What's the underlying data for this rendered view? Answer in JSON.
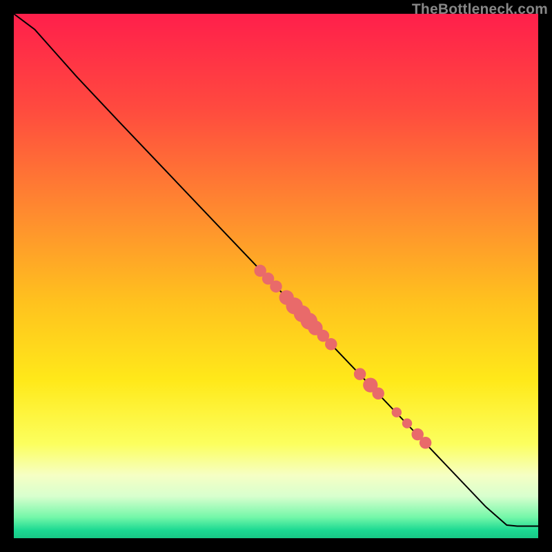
{
  "watermark": "TheBottleneck.com",
  "chart_data": {
    "type": "line",
    "title": "",
    "xlabel": "",
    "ylabel": "",
    "xlim": [
      0,
      100
    ],
    "ylim": [
      0,
      100
    ],
    "gradient_stops": [
      {
        "offset": 0,
        "color": "#ff1f4b"
      },
      {
        "offset": 18,
        "color": "#ff4a3f"
      },
      {
        "offset": 38,
        "color": "#ff8b2f"
      },
      {
        "offset": 55,
        "color": "#ffc21e"
      },
      {
        "offset": 70,
        "color": "#ffe91a"
      },
      {
        "offset": 82,
        "color": "#fcff5e"
      },
      {
        "offset": 88,
        "color": "#f6ffc4"
      },
      {
        "offset": 92,
        "color": "#d8ffce"
      },
      {
        "offset": 96,
        "color": "#74f7a9"
      },
      {
        "offset": 98.5,
        "color": "#1bd992"
      },
      {
        "offset": 100,
        "color": "#18c986"
      }
    ],
    "curve": [
      {
        "x": 0,
        "y": 100
      },
      {
        "x": 4,
        "y": 97
      },
      {
        "x": 8,
        "y": 92.5
      },
      {
        "x": 12,
        "y": 88
      },
      {
        "x": 20,
        "y": 79.5
      },
      {
        "x": 30,
        "y": 69
      },
      {
        "x": 40,
        "y": 58.5
      },
      {
        "x": 50,
        "y": 48
      },
      {
        "x": 60,
        "y": 37.5
      },
      {
        "x": 70,
        "y": 27
      },
      {
        "x": 80,
        "y": 16.5
      },
      {
        "x": 90,
        "y": 6
      },
      {
        "x": 94,
        "y": 2.5
      },
      {
        "x": 96,
        "y": 2.3
      },
      {
        "x": 100,
        "y": 2.3
      }
    ],
    "points": [
      {
        "x": 47,
        "y": 51,
        "r": 1.15
      },
      {
        "x": 48.5,
        "y": 49.5,
        "r": 1.15
      },
      {
        "x": 50,
        "y": 48,
        "r": 1.15
      },
      {
        "x": 52,
        "y": 45.9,
        "r": 1.4
      },
      {
        "x": 53.5,
        "y": 44.3,
        "r": 1.6
      },
      {
        "x": 55,
        "y": 42.8,
        "r": 1.6
      },
      {
        "x": 56.3,
        "y": 41.4,
        "r": 1.6
      },
      {
        "x": 57.5,
        "y": 40.1,
        "r": 1.4
      },
      {
        "x": 59,
        "y": 38.6,
        "r": 1.15
      },
      {
        "x": 60.5,
        "y": 37,
        "r": 1.15
      },
      {
        "x": 66,
        "y": 31.3,
        "r": 1.15
      },
      {
        "x": 68,
        "y": 29.2,
        "r": 1.4
      },
      {
        "x": 69.5,
        "y": 27.6,
        "r": 1.15
      },
      {
        "x": 73,
        "y": 24,
        "r": 0.95
      },
      {
        "x": 75,
        "y": 21.9,
        "r": 0.95
      },
      {
        "x": 77,
        "y": 19.8,
        "r": 1.15
      },
      {
        "x": 78.5,
        "y": 18.2,
        "r": 1.15
      }
    ],
    "point_color": "#e96a6a",
    "curve_color": "#000000",
    "curve_width": 2
  }
}
